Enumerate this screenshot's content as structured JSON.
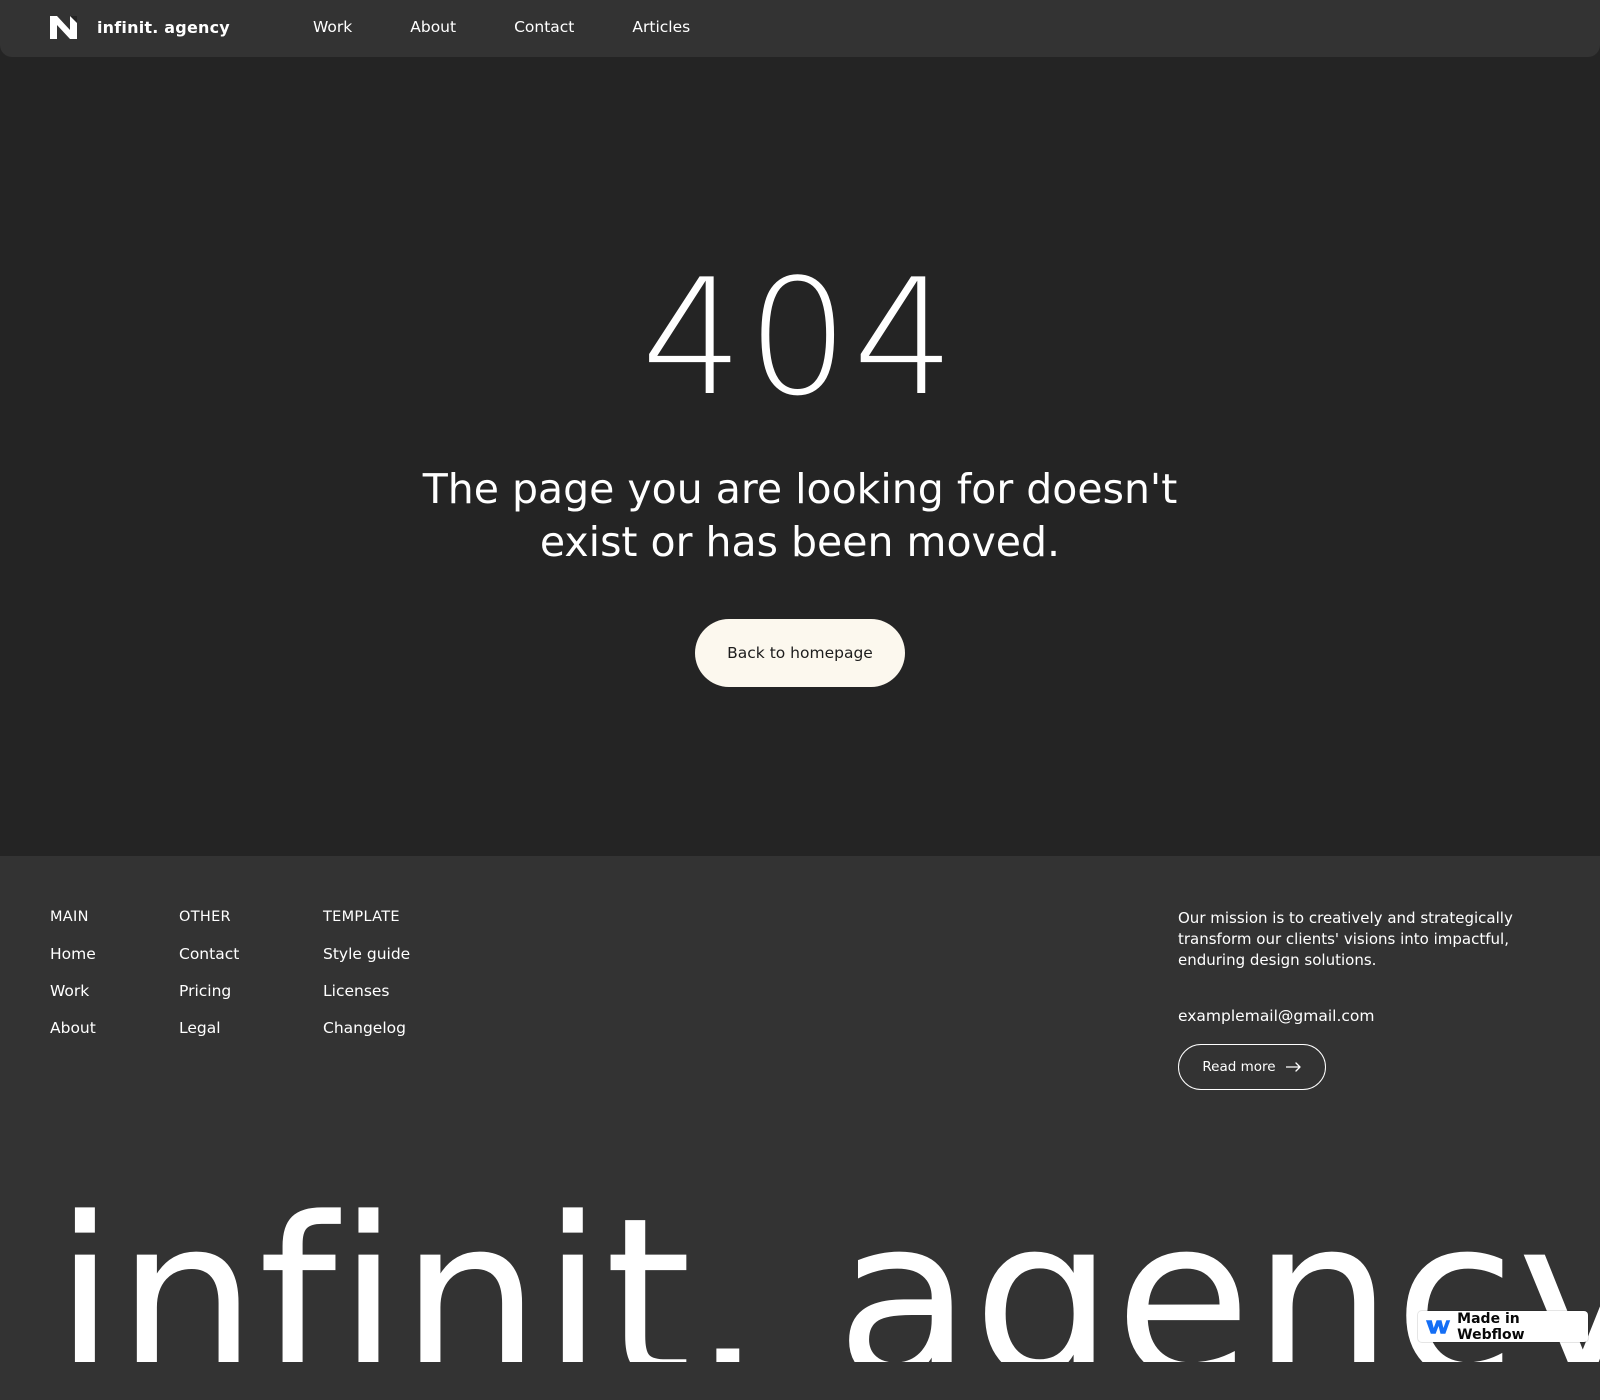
{
  "nav": {
    "brand": "infinit. agency",
    "links": [
      "Work",
      "About",
      "Contact",
      "Articles"
    ]
  },
  "hero": {
    "code": "404",
    "message": "The page you are looking for doesn't exist or has been moved.",
    "button_label": "Back to homepage"
  },
  "footer": {
    "columns": [
      {
        "title": "MAIN",
        "links": [
          "Home",
          "Work",
          "About"
        ]
      },
      {
        "title": "OTHER",
        "links": [
          "Contact",
          "Pricing",
          "Legal"
        ]
      },
      {
        "title": "TEMPLATE",
        "links": [
          "Style guide",
          "Licenses",
          "Changelog"
        ]
      }
    ],
    "mission": "Our mission is to creatively and strategically transform our clients' visions into impactful, enduring design solutions.",
    "email": "examplemail@gmail.com",
    "read_more_label": "Read more",
    "wordmark": "infinit. agency"
  },
  "badge": {
    "label": "Made in Webflow"
  },
  "colors": {
    "hero_bg": "#242424",
    "footer_bg": "#333333",
    "button_bg": "#fcf8ee",
    "webflow_blue": "#146ef5"
  },
  "icons": [
    "logo-icon",
    "arrow-right-icon",
    "webflow-icon"
  ]
}
